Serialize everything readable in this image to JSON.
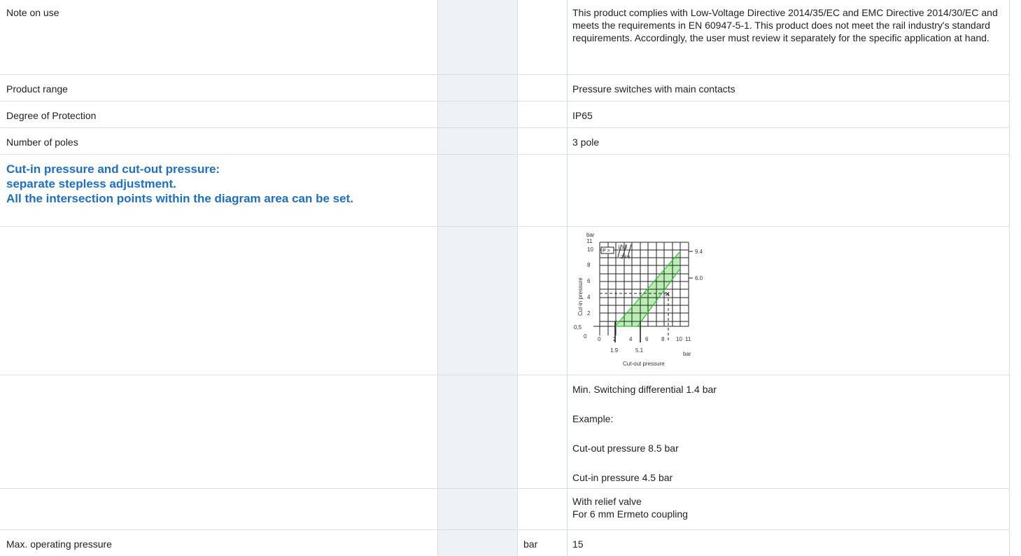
{
  "rows": {
    "note": {
      "label": "Note on use",
      "value": "This product complies with Low-Voltage Directive 2014/35/EC and EMC Directive 2014/30/EC and meets the requirements in EN 60947-5-1. This product does not meet the rail industry's standard requirements. Accordingly, the user must review it separately for the specific application at hand."
    },
    "product_range": {
      "label": "Product range",
      "value": "Pressure switches with main contacts"
    },
    "protection": {
      "label": "Degree of Protection",
      "value": "IP65"
    },
    "poles": {
      "label": "Number of poles",
      "value": "3 pole"
    },
    "heading": {
      "line1": "Cut-in pressure and cut-out pressure:",
      "line2": "separate stepless adjustment.",
      "line3": "All the intersection points within the diagram area can be set."
    },
    "example": {
      "min_diff": "Min. Switching differential 1.4 bar",
      "example_label": "Example:",
      "cut_out": "Cut-out pressure 8.5 bar",
      "cut_in": "Cut-in pressure 4.5 bar"
    },
    "relief": {
      "line1": "With relief valve",
      "line2": "For 6 mm Ermeto coupling"
    },
    "max_pressure": {
      "label": "Max. operating pressure",
      "unit": "bar",
      "value": "15"
    }
  },
  "diagram": {
    "y_unit": "bar",
    "y_top": "11",
    "y_ticks": [
      "10",
      "8",
      "6",
      "4",
      "2",
      "0,5",
      "0"
    ],
    "ylabel": "Cut-in pressure",
    "x_ticks": [
      "0",
      "2",
      "4",
      "6",
      "8",
      "10",
      "11"
    ],
    "x_unit": "bar",
    "xlabel": "Cut-out pressure",
    "marks_below": [
      "1.9",
      "5.1"
    ],
    "marks_right": [
      "9.4",
      "6.0"
    ],
    "symbol_p": "P >",
    "symbol_top": "1 3 5",
    "symbol_bottom": "2 4 6",
    "example_marker": "×",
    "band_color": "#b9efb3",
    "band_line_color": "#2fbf38"
  }
}
